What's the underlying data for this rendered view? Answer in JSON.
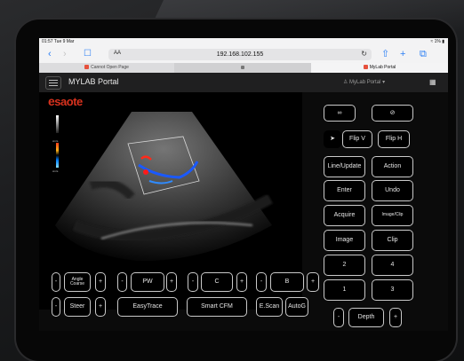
{
  "status_bar": {
    "time": "01:57  Tue 9 Mar",
    "battery": "≈ 1% ▮"
  },
  "browser": {
    "nav_back": "‹",
    "nav_forward": "›",
    "reader_icon": "☐",
    "aa_label": "AA",
    "url": "192.168.102.155",
    "reload": "↻",
    "share": "⇧",
    "new_tab": "+",
    "tabs_icon": "⧉",
    "tabs": [
      {
        "title": "Cannot Open Page"
      },
      {
        "title": ""
      },
      {
        "title": "MyLab Portal"
      }
    ]
  },
  "app": {
    "title": "MYLAB Portal",
    "user_menu": "♙ MyLab Portal ▾",
    "grid_icon": "▦"
  },
  "viewer": {
    "logo": "saote",
    "logo_prefix": "e",
    "scale_top": "cm/s",
    "scale_bottom": "cm/s"
  },
  "controls": {
    "icon_a": "∞",
    "icon_b": "⊘",
    "pointer": "➤",
    "flip_v": "Flip V",
    "flip_h": "Flip H",
    "line_update": "Line/Update",
    "action": "Action",
    "enter": "Enter",
    "undo": "Undo",
    "acquire": "Acquire",
    "image_clip": "Image/Clip",
    "image": "Image",
    "clip": "Clip",
    "num_2": "2",
    "num_4": "4",
    "num_1": "1",
    "num_3": "3",
    "depth": "Depth",
    "minus": "-",
    "plus": "+"
  },
  "bottom_controls": {
    "angle_coarse": "Angle Coarse",
    "pw": "PW",
    "c": "C",
    "b": "B",
    "steer": "Steer",
    "easytrace": "EasyTrace",
    "smart_cfm": "Smart CFM",
    "e_scan": "E.Scan",
    "autog": "AutoG",
    "minus": "-",
    "plus": "+"
  }
}
